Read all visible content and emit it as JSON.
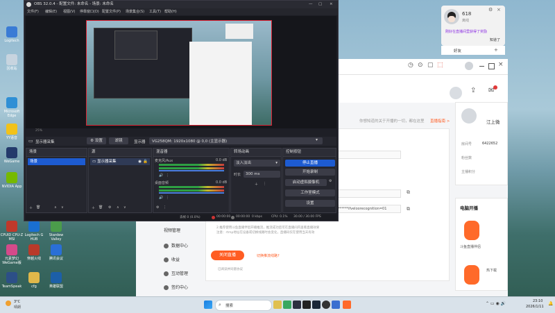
{
  "desktop_icons": [
    {
      "label": "Logitech",
      "color": "#3a7bd5"
    },
    {
      "label": "回收站",
      "color": "#c7d4df"
    },
    {
      "label": "Microsoft Edge",
      "color": "#2f8fd5"
    },
    {
      "label": "YY语音",
      "color": "#f2c21a"
    },
    {
      "label": "WeGame",
      "color": "#243a6b"
    },
    {
      "label": "NVIDIA App",
      "color": "#76b900"
    },
    {
      "label": "CPUID CPU-Z MSI",
      "color": "#c0392b"
    },
    {
      "label": "Logitech G HUB",
      "color": "#1a6fd1"
    },
    {
      "label": "Stardew Valley",
      "color": "#4b9c4b"
    },
    {
      "label": "元素梦幻 WeGame版",
      "color": "#d44a8a"
    },
    {
      "label": "穿越火线",
      "color": "#b83a2a"
    },
    {
      "label": "腾讯会议",
      "color": "#2a6fd6"
    },
    {
      "label": "TeamSpeak",
      "color": "#2c4f87"
    },
    {
      "label": "cfg",
      "color": "#e0b84a"
    },
    {
      "label": "英雄联盟",
      "color": "#1c5fa8"
    }
  ],
  "chat_notification": {
    "name": "618",
    "status": "离线",
    "message": "刚好在直播间里获得了奖励",
    "action": "知道了"
  },
  "friend_tab": "好友",
  "obs": {
    "title": "OBS 32.0.4 - 配置文件: 未命名 - 场景: 未命名",
    "menu": [
      "文件(F)",
      "编辑(E)",
      "视图(V)",
      "停靠窗口(D)",
      "配置文件(P)",
      "场景集合(S)",
      "工具(T)",
      "帮助(H)"
    ],
    "preview_footer": "25%",
    "source_toolbar": {
      "scene_label": "显示器采集",
      "settings": "设置",
      "filters": "滤镜",
      "display_label": "显示器",
      "display_value": "VG258QM: 1920x1080 @ 0,0 (主显示器)"
    },
    "docks": {
      "scenes": {
        "title": "场景",
        "items": [
          "场景"
        ]
      },
      "sources": {
        "title": "源",
        "items": [
          "显示器采集"
        ]
      },
      "mixer": {
        "title": "混音器",
        "tracks": [
          {
            "name": "麦克风/Aux",
            "db": "0.0 dB"
          },
          {
            "name": "桌面音频",
            "db": "0.0 dB"
          }
        ]
      },
      "transitions": {
        "title": "转场动画",
        "type": "淡入淡出",
        "duration_label": "时长",
        "duration": "300 ms"
      },
      "controls": {
        "title": "控制按钮",
        "buttons": [
          "停止直播",
          "开始录制",
          "启动虚拟摄像机",
          "工作室模式",
          "设置",
          "退出"
        ]
      }
    },
    "status": {
      "dropped": "丢帧 0 (0.0%)",
      "live": "00:00:00",
      "rec": "00:00:00",
      "kbps": "0 kbps",
      "cpu": "CPU: 0.1%",
      "fps": "30.00 / 30.00 FPS"
    }
  },
  "browser": {
    "side_menu": [
      "视频管理",
      "数据中心",
      "收益",
      "互动管理",
      "签约中心"
    ],
    "hint": "你想知道的关于开播的一切，都在这里",
    "hint_link": "直播指南 >",
    "stream_key_mask": "**********ifveloorecognition=01",
    "instructions": [
      "2.推荐使用斗鱼直播伴侣开播推流，推流成功后可在直播间内查看直播效果",
      "注意：rtmp地址在设备或切换线路时会变化，直播码仅在使用当天有效"
    ],
    "close_button": "关闭直播",
    "switch_link": "切换推流线路?",
    "bottom_note": "已阅读并同意协议",
    "profile": {
      "name": "江上微",
      "room_label": "房间号",
      "room_value": "6422652",
      "fans_label": "粉丝数",
      "score_label": "主播积分"
    },
    "pc_section": "电脑开播",
    "assistant": "斗鱼直播伴侣",
    "download": "热下载"
  },
  "taskbar": {
    "search": "搜索",
    "weather": "3°C",
    "weather_desc": "晴朗",
    "time": "23:10",
    "date": "2026/1/11"
  }
}
